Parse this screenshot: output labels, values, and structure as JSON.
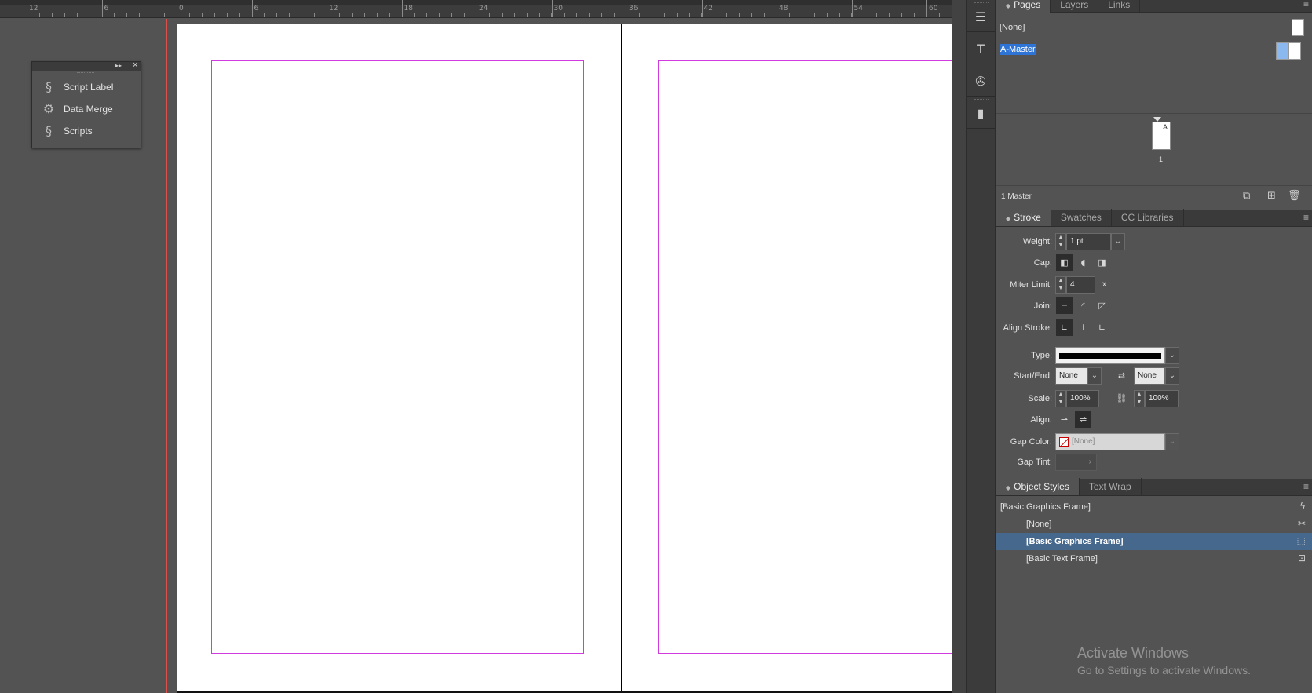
{
  "ruler": {
    "labels": [
      "12",
      "6",
      "0",
      "6",
      "12",
      "18",
      "24",
      "30",
      "36",
      "42",
      "48",
      "54",
      "60"
    ]
  },
  "scripts_panel": {
    "collapse_glyph": "▸▸",
    "close_glyph": "✕",
    "items": [
      {
        "label": "Script Label",
        "icon": "script-label-icon"
      },
      {
        "label": "Data Merge",
        "icon": "data-merge-icon"
      },
      {
        "label": "Scripts",
        "icon": "scripts-icon"
      }
    ]
  },
  "pages_panel": {
    "tabs": [
      "Pages",
      "Layers",
      "Links"
    ],
    "active_tab": "Pages",
    "masters": [
      {
        "label": "[None]",
        "selected": false
      },
      {
        "label": "A-Master",
        "selected": true
      }
    ],
    "page_master_letter": "A",
    "page_number": "1",
    "footer_text": "1 Master"
  },
  "stroke_panel": {
    "tabs": [
      "Stroke",
      "Swatches",
      "CC Libraries"
    ],
    "active_tab": "Stroke",
    "weight_label": "Weight:",
    "weight_value": "1 pt",
    "cap_label": "Cap:",
    "miter_label": "Miter Limit:",
    "miter_value": "4",
    "miter_unit": "x",
    "join_label": "Join:",
    "align_stroke_label": "Align Stroke:",
    "type_label": "Type:",
    "startend_label": "Start/End:",
    "start_value": "None",
    "end_value": "None",
    "scale_label": "Scale:",
    "scale_start": "100%",
    "scale_end": "100%",
    "align_label": "Align:",
    "gap_color_label": "Gap Color:",
    "gap_color_value": "[None]",
    "gap_tint_label": "Gap Tint:"
  },
  "object_styles_panel": {
    "tabs": [
      "Object Styles",
      "Text Wrap"
    ],
    "active_tab": "Object Styles",
    "current_style": "[Basic Graphics Frame]",
    "styles": [
      {
        "label": "[None]",
        "selected": false,
        "icon": "clear-style-icon"
      },
      {
        "label": "[Basic Graphics Frame]",
        "selected": true,
        "icon": "graphics-frame-icon"
      },
      {
        "label": "[Basic Text Frame]",
        "selected": false,
        "icon": "text-frame-icon"
      }
    ]
  },
  "watermark": {
    "title": "Activate Windows",
    "subtitle": "Go to Settings to activate Windows."
  },
  "colors": {
    "margin_guide": "#d03adf",
    "selection": "#2e73d6",
    "row_selected": "#46688d"
  }
}
